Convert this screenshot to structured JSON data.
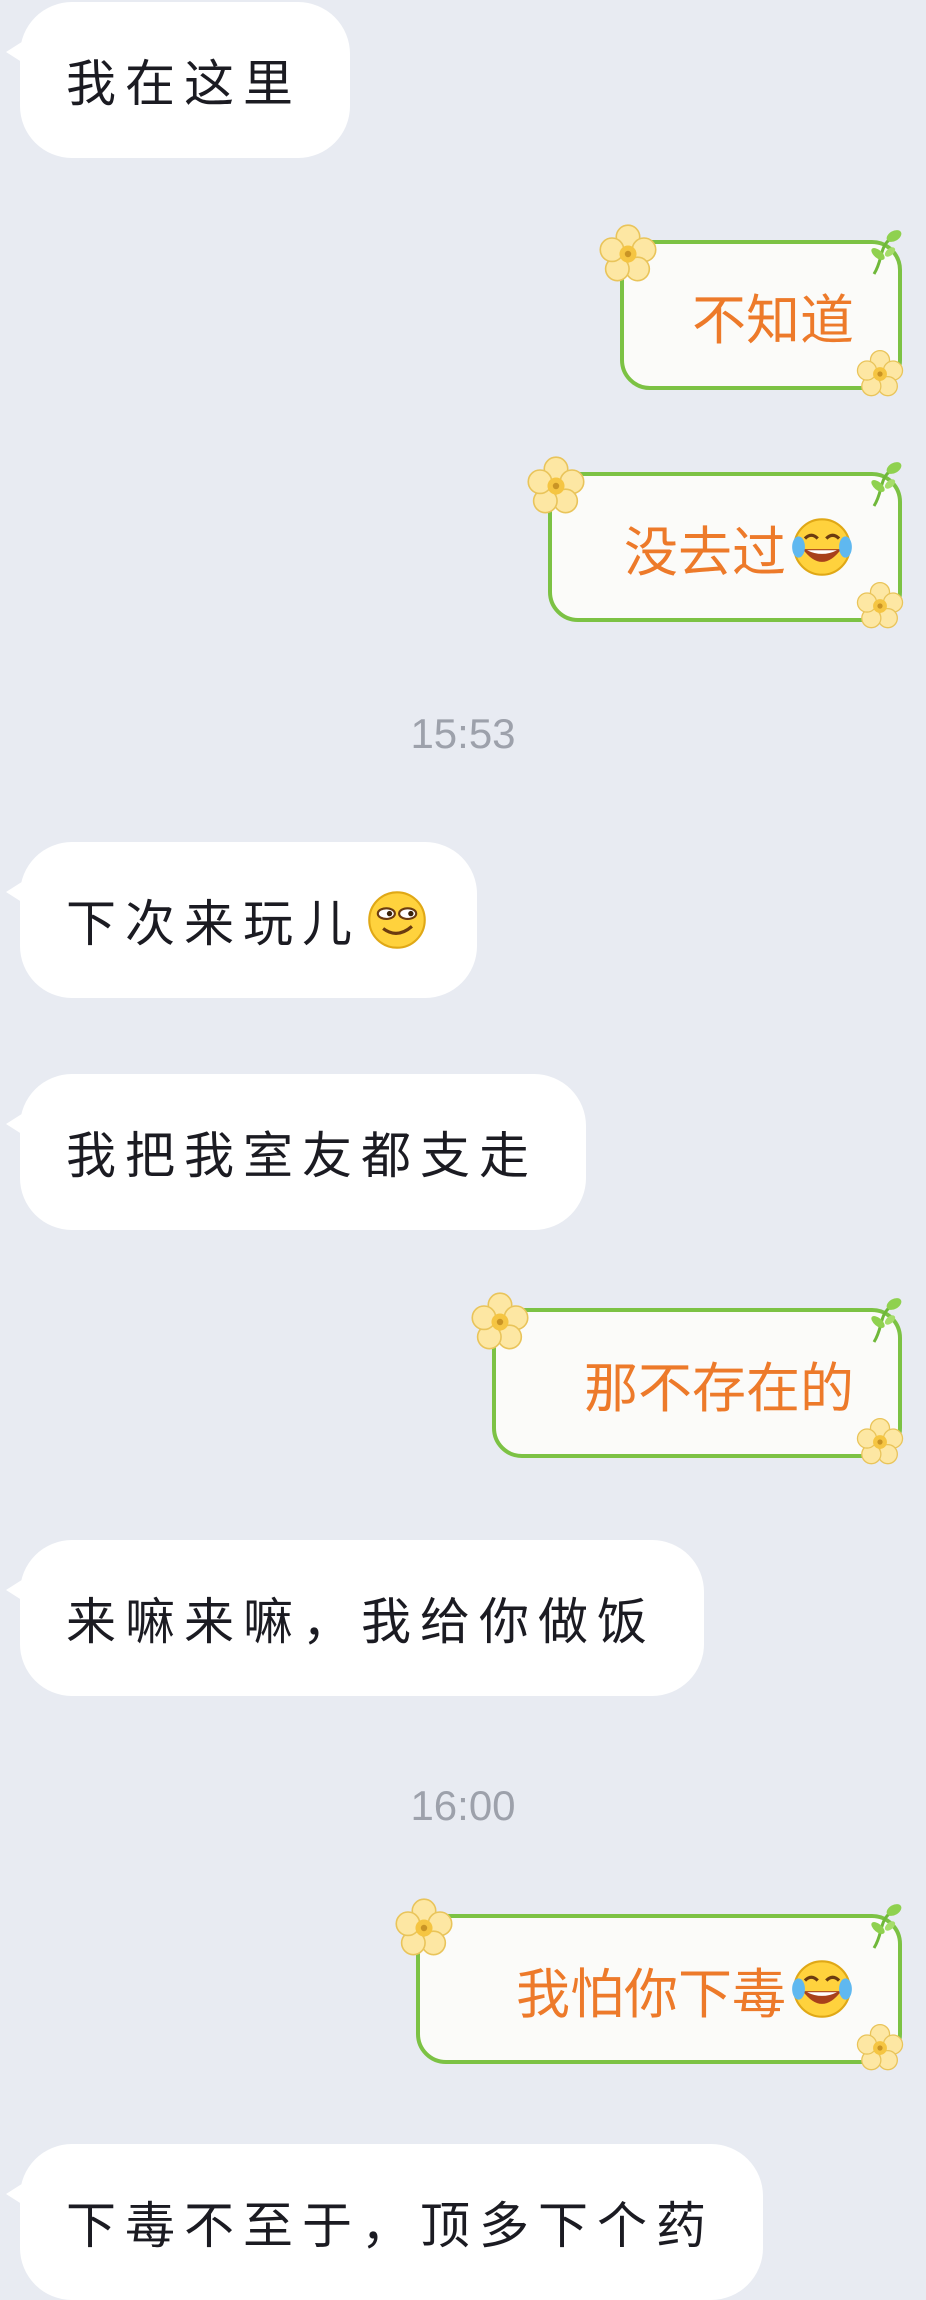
{
  "messages": [
    {
      "side": "in",
      "text": "我在这里"
    },
    {
      "side": "out",
      "text": "不知道"
    },
    {
      "side": "out",
      "text": "没去过",
      "emoji": "laughing-tears-emoji"
    },
    {
      "type": "time",
      "text": "15:53"
    },
    {
      "side": "in",
      "text": "下次来玩儿",
      "emoji": "smirk-emoji"
    },
    {
      "side": "in",
      "text": "我把我室友都支走"
    },
    {
      "side": "out",
      "text": "那不存在的"
    },
    {
      "side": "in",
      "text": "来嘛来嘛，我给你做饭"
    },
    {
      "type": "time",
      "text": "16:00"
    },
    {
      "side": "out",
      "text": "我怕你下毒",
      "emoji": "laughing-tears-emoji"
    },
    {
      "side": "in",
      "text": "下毒不至于，顶多下个药"
    }
  ],
  "colors": {
    "background": "#e8ebf2",
    "incoming_bubble": "#ffffff",
    "outgoing_border": "#7cc244",
    "outgoing_text": "#ed7a2a",
    "incoming_text": "#1b1b22",
    "timestamp": "#9da1ab"
  }
}
